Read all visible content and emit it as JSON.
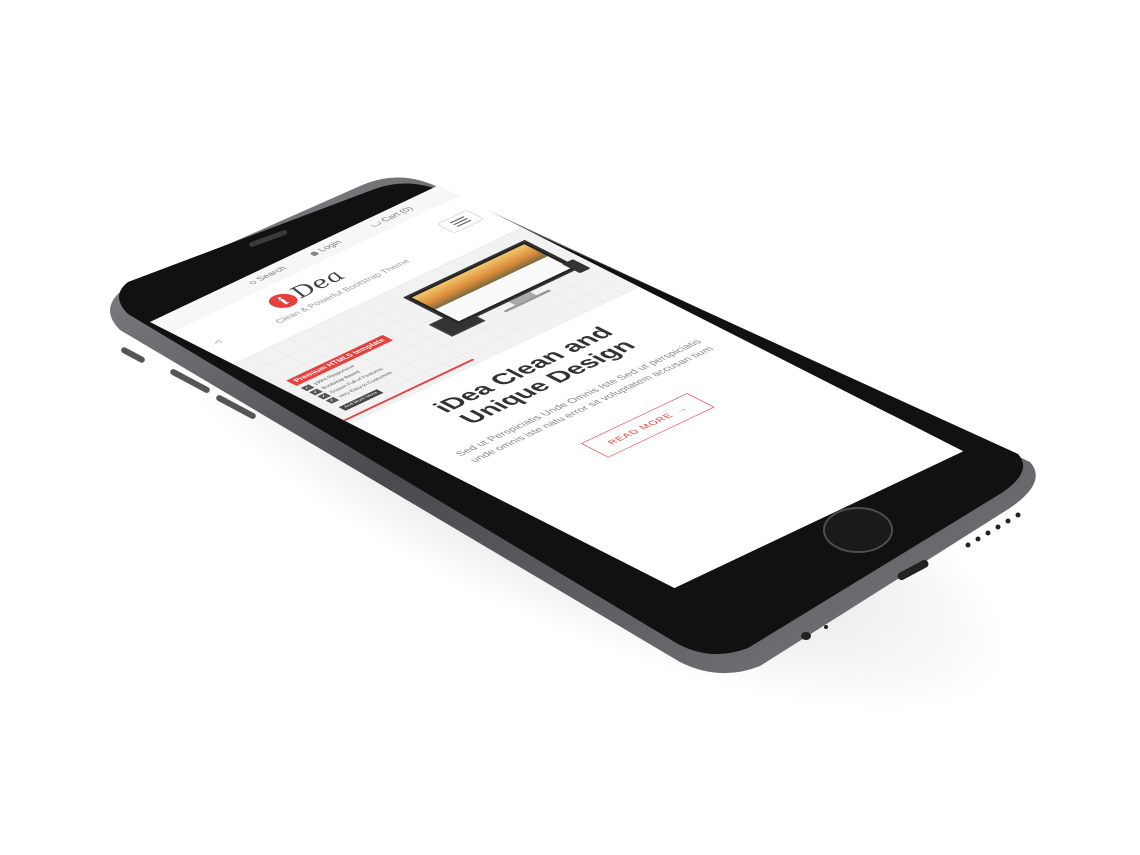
{
  "topbar": {
    "search_label": "Search",
    "login_label": "Login",
    "cart_label": "Cart (0)"
  },
  "header": {
    "logo_mark": "i",
    "logo_text": "Dea",
    "tagline": "Clean & Powerful Bootstrap Theme"
  },
  "hero": {
    "badge": "Premium HTML5 template",
    "features": [
      "100% Responsive",
      "Bootstrap Based",
      "Screen Full of Features",
      "Very Easy to Customize"
    ],
    "more_label": "And Much More"
  },
  "main": {
    "title_line1": "iDea Clean and",
    "title_line2": "Unique Design",
    "subtitle": "Sed ut Perspiciatis Unde Omnis Iste Sed ut perspiciatis unde omnis iste natu error sit voluptatem accusan tium",
    "read_more_label": "READ MORE"
  },
  "colors": {
    "accent": "#e6403c",
    "phone_body": "#2b2b2d",
    "phone_frame": "#6a6a6e"
  }
}
